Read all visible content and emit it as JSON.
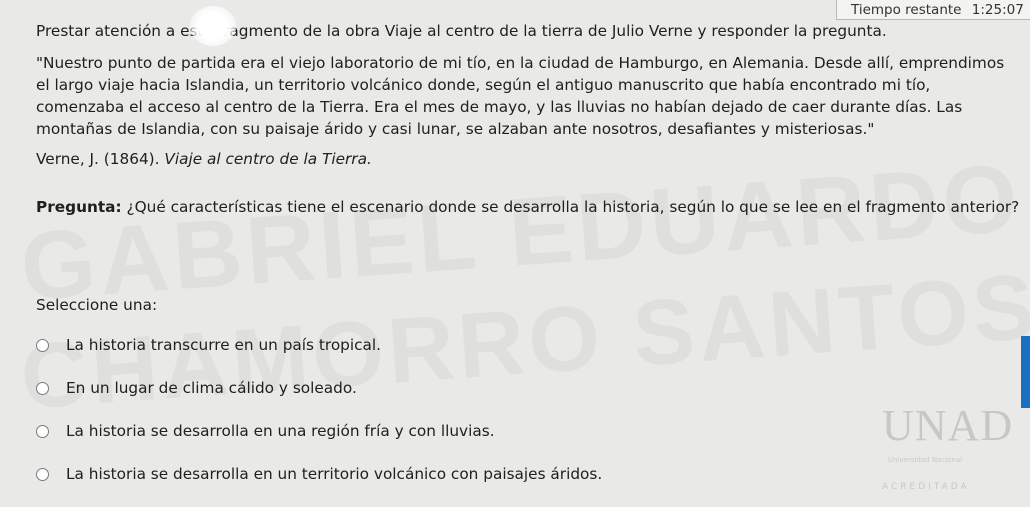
{
  "timer": {
    "label": "Tiempo restante",
    "value": "1:25:07"
  },
  "question": {
    "intro": "Prestar atención a este fragmento de la obra Viaje al centro de la tierra de Julio Verne y responder la pregunta.",
    "quote": "\"Nuestro punto de partida era el viejo laboratorio de mi tío, en la ciudad de Hamburgo, en Alemania. Desde allí, emprendimos el largo viaje hacia Islandia, un territorio volcánico donde, según el antiguo manuscrito que había encontrado mi tío, comenzaba el acceso al centro de la Tierra. Era el mes de mayo, y las lluvias no habían dejado de caer durante días. Las montañas de Islandia, con su paisaje árido y casi lunar, se alzaban ante nosotros, desafiantes y misteriosas.\"",
    "citation_author": "Verne, J. (1864).",
    "citation_work": "Viaje al centro de la Tierra.",
    "prompt_label": "Pregunta:",
    "prompt_text": "¿Qué características tiene el escenario donde se desarrolla la historia, según lo que se lee en el fragmento anterior?"
  },
  "select_label": "Seleccione una:",
  "options": [
    {
      "label": "La historia transcurre en un país tropical."
    },
    {
      "label": "En un lugar de clima cálido y soleado."
    },
    {
      "label": "La historia se desarrolla en una región fría y con lluvias."
    },
    {
      "label": "La historia se desarrolla en un territorio volcánico con paisajes áridos."
    }
  ],
  "watermark": {
    "line1": "GABRIEL EDUARDO",
    "line2": "CHAMORRO SANTOS"
  },
  "logo": {
    "mark": "UNAD",
    "sub": "Universidad Nacional",
    "accredited": "ACREDITADA"
  },
  "colors": {
    "background": "#e9e9e7",
    "text": "#1f1f1f",
    "accent": "#1b6fc2"
  }
}
